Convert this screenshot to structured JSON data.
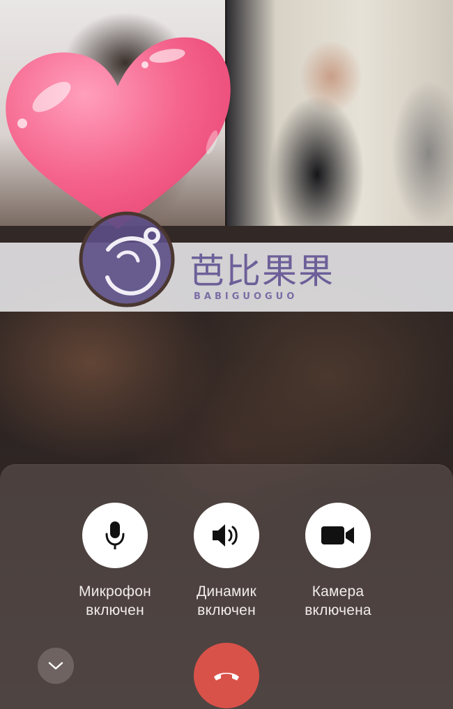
{
  "call": {
    "controls": [
      {
        "id": "microphone",
        "icon": "microphone-icon",
        "label_line1": "Микрофон",
        "label_line2": "включен"
      },
      {
        "id": "speaker",
        "icon": "speaker-icon",
        "label_line1": "Динамик",
        "label_line2": "включен"
      },
      {
        "id": "camera",
        "icon": "video-camera-icon",
        "label_line1": "Камера",
        "label_line2": "включена"
      }
    ],
    "collapse_icon": "chevron-down-icon",
    "hangup_icon": "phone-hangup-icon",
    "hangup_color": "#d9524a"
  },
  "watermark": {
    "chinese": "芭比果果",
    "latin": "BABIGUOGUO",
    "color": "#6d5f99"
  },
  "sticker": {
    "icon": "heart-sticker-icon",
    "color": "#f06088"
  }
}
